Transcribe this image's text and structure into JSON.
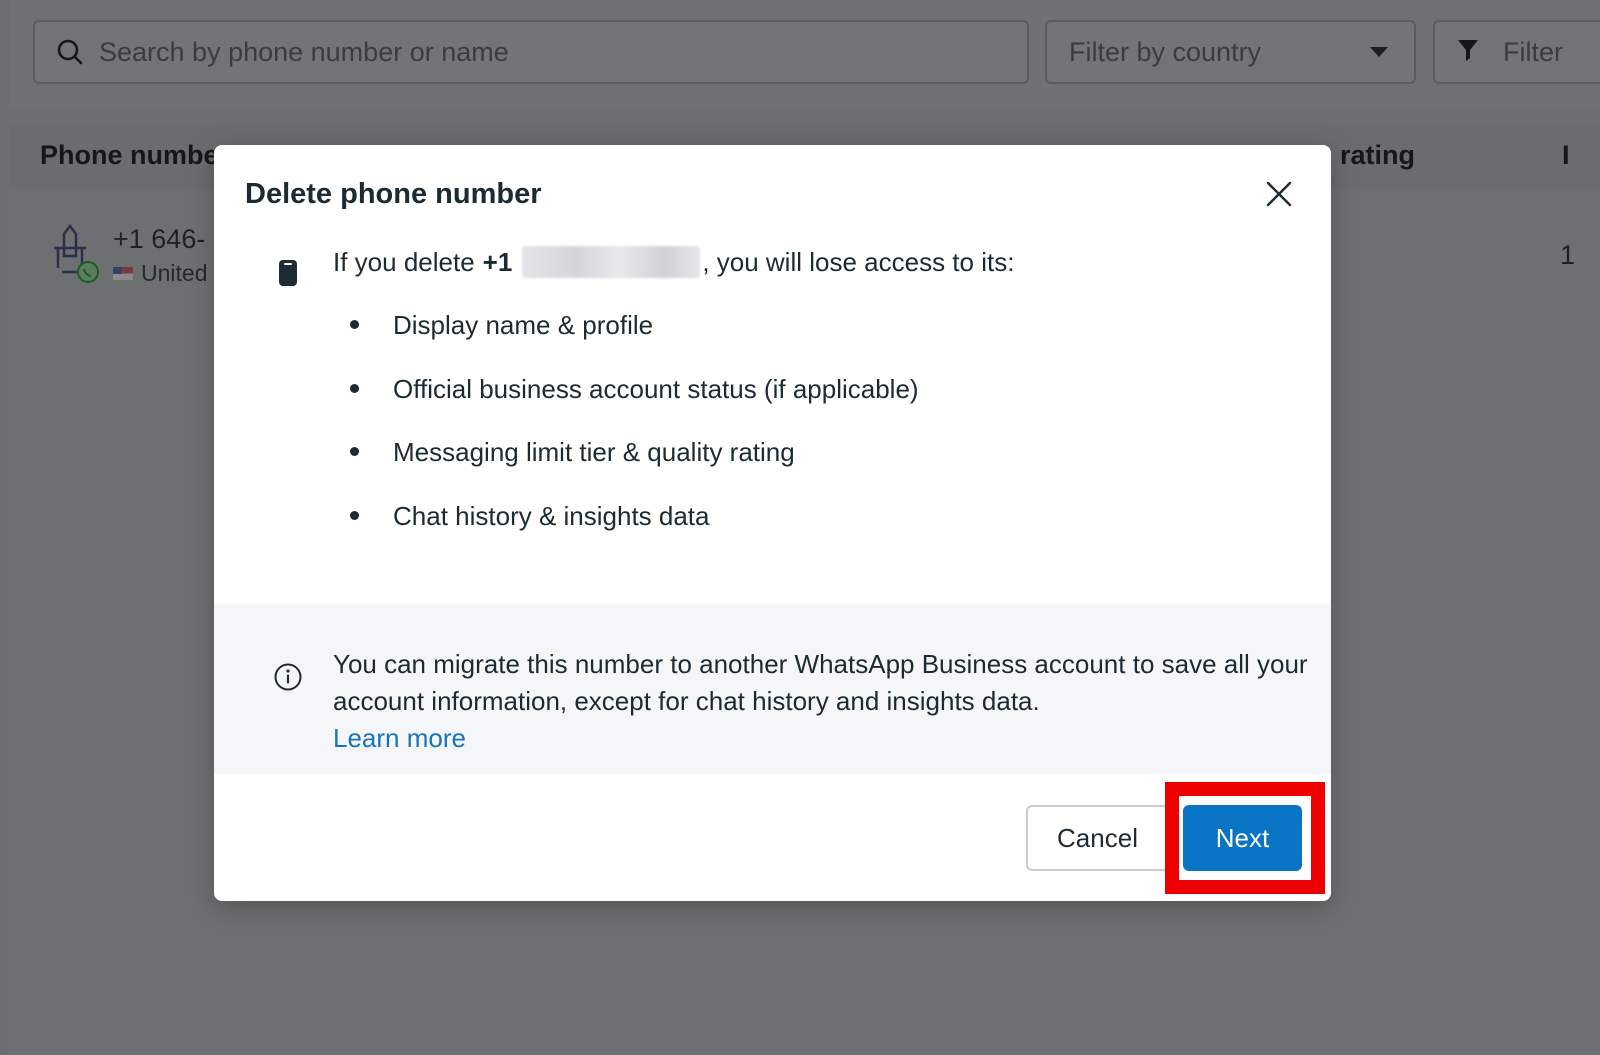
{
  "background": {
    "search": {
      "placeholder": "Search by phone number or name"
    },
    "country_filter": {
      "placeholder": "Filter by country"
    },
    "filter_button": {
      "label": "Filter"
    },
    "table": {
      "headers": [
        "Phone numbe",
        "rating",
        "I"
      ],
      "rows": [
        {
          "number": "+1 646-",
          "country": "United",
          "tail": "1"
        }
      ]
    }
  },
  "modal": {
    "title": "Delete phone number",
    "lead_prefix": "If you delete",
    "lead_code": "+1",
    "lead_suffix": ", you will lose access to its:",
    "items": [
      "Display name & profile",
      "Official business account status (if applicable)",
      "Messaging limit tier & quality rating",
      "Chat history & insights data"
    ],
    "notice": "You can migrate this number to another WhatsApp Business account to save all your account information, except for chat history and insights data.",
    "learn_more": "Learn more",
    "cancel_label": "Cancel",
    "next_label": "Next"
  },
  "colors": {
    "primary": "#0a74c4",
    "link": "#1874bb",
    "highlight": "#ee0000",
    "overlay": "#6d6e70"
  },
  "icons": [
    "search-icon",
    "chevron-down-icon",
    "filter-icon",
    "app-logo-icon",
    "whatsapp-icon",
    "close-icon",
    "phone-icon",
    "info-icon"
  ]
}
